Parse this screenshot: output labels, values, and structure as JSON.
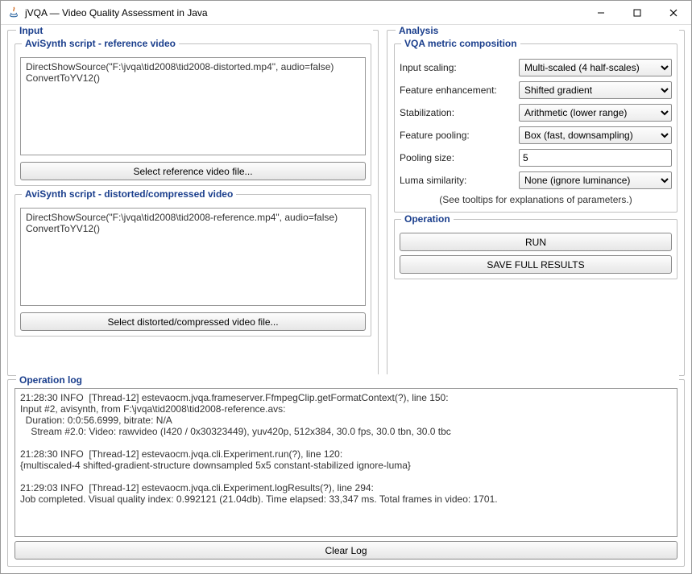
{
  "window": {
    "title": "jVQA — Video Quality Assessment in Java"
  },
  "input": {
    "legend": "Input",
    "ref": {
      "legend": "AviSynth script - reference video",
      "script": "DirectShowSource(\"F:\\jvqa\\tid2008\\tid2008-distorted.mp4\", audio=false)\nConvertToYV12()",
      "button": "Select reference video file..."
    },
    "dist": {
      "legend": "AviSynth script - distorted/compressed video",
      "script": "DirectShowSource(\"F:\\jvqa\\tid2008\\tid2008-reference.mp4\", audio=false)\nConvertToYV12()",
      "button": "Select distorted/compressed video file..."
    }
  },
  "analysis": {
    "legend": "Analysis",
    "vqa": {
      "legend": "VQA metric composition",
      "rows": {
        "input_scaling": {
          "label": "Input scaling:",
          "value": "Multi-scaled (4 half-scales)"
        },
        "feat_enh": {
          "label": "Feature enhancement:",
          "value": "Shifted gradient"
        },
        "stab": {
          "label": "Stabilization:",
          "value": "Arithmetic (lower range)"
        },
        "feat_pool": {
          "label": "Feature pooling:",
          "value": "Box (fast, downsampling)"
        },
        "pool_size": {
          "label": "Pooling size:",
          "value": "5"
        },
        "luma": {
          "label": "Luma similarity:",
          "value": "None (ignore luminance)"
        }
      },
      "hint": "(See tooltips for explanations of parameters.)"
    },
    "operation": {
      "legend": "Operation",
      "run": "RUN",
      "save": "SAVE FULL RESULTS"
    }
  },
  "oplog": {
    "legend": "Operation log",
    "text": "21:28:30 INFO  [Thread-12] estevaocm.jvqa.frameserver.FfmpegClip.getFormatContext(?), line 150:\nInput #2, avisynth, from F:\\jvqa\\tid2008\\tid2008-reference.avs:\n  Duration: 0:0:56.6999, bitrate: N/A\n    Stream #2.0: Video: rawvideo (I420 / 0x30323449), yuv420p, 512x384, 30.0 fps, 30.0 tbn, 30.0 tbc\n\n21:28:30 INFO  [Thread-12] estevaocm.jvqa.cli.Experiment.run(?), line 120:\n{multiscaled-4 shifted-gradient-structure downsampled 5x5 constant-stabilized ignore-luma}\n\n21:29:03 INFO  [Thread-12] estevaocm.jvqa.cli.Experiment.logResults(?), line 294:\nJob completed. Visual quality index: 0.992121 (21.04db). Time elapsed: 33,347 ms. Total frames in video: 1701.\n",
    "clear": "Clear Log"
  }
}
